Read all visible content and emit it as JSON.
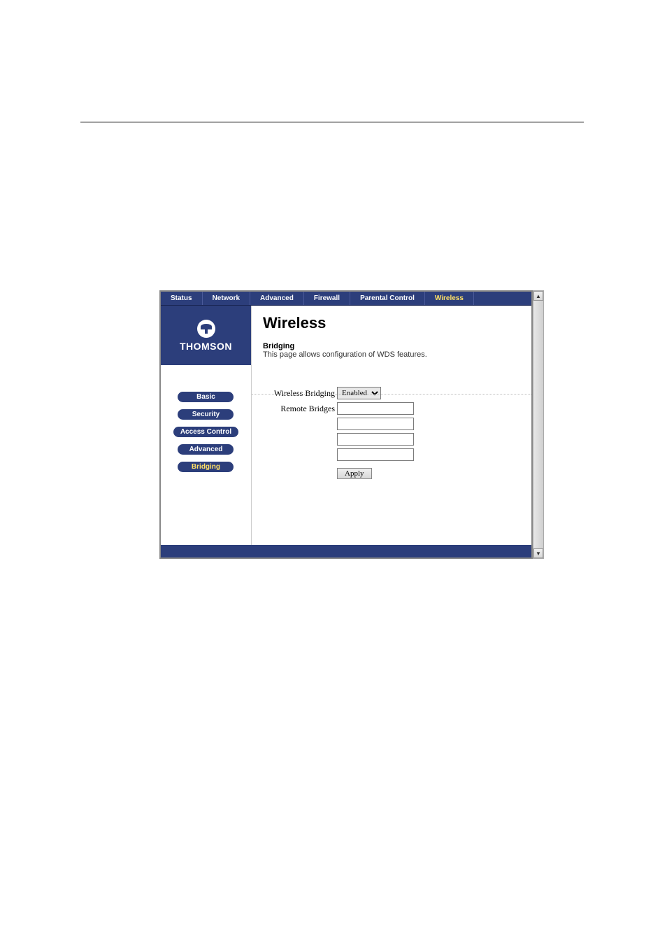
{
  "topnav": {
    "items": [
      {
        "label": "Status"
      },
      {
        "label": "Network"
      },
      {
        "label": "Advanced"
      },
      {
        "label": "Firewall"
      },
      {
        "label": "Parental Control"
      },
      {
        "label": "Wireless"
      }
    ]
  },
  "brand": {
    "name": "THOMSON"
  },
  "sidebar": {
    "items": [
      {
        "label": "Basic"
      },
      {
        "label": "Security"
      },
      {
        "label": "Access Control"
      },
      {
        "label": "Advanced"
      },
      {
        "label": "Bridging"
      }
    ]
  },
  "main": {
    "title": "Wireless",
    "section_title": "Bridging",
    "section_desc": "This page allows configuration of WDS features.",
    "form": {
      "bridging_label": "Wireless Bridging",
      "bridging_value": "Enabled",
      "remote_label": "Remote Bridges",
      "remote_values": [
        "",
        "",
        "",
        ""
      ],
      "apply_label": "Apply"
    }
  }
}
